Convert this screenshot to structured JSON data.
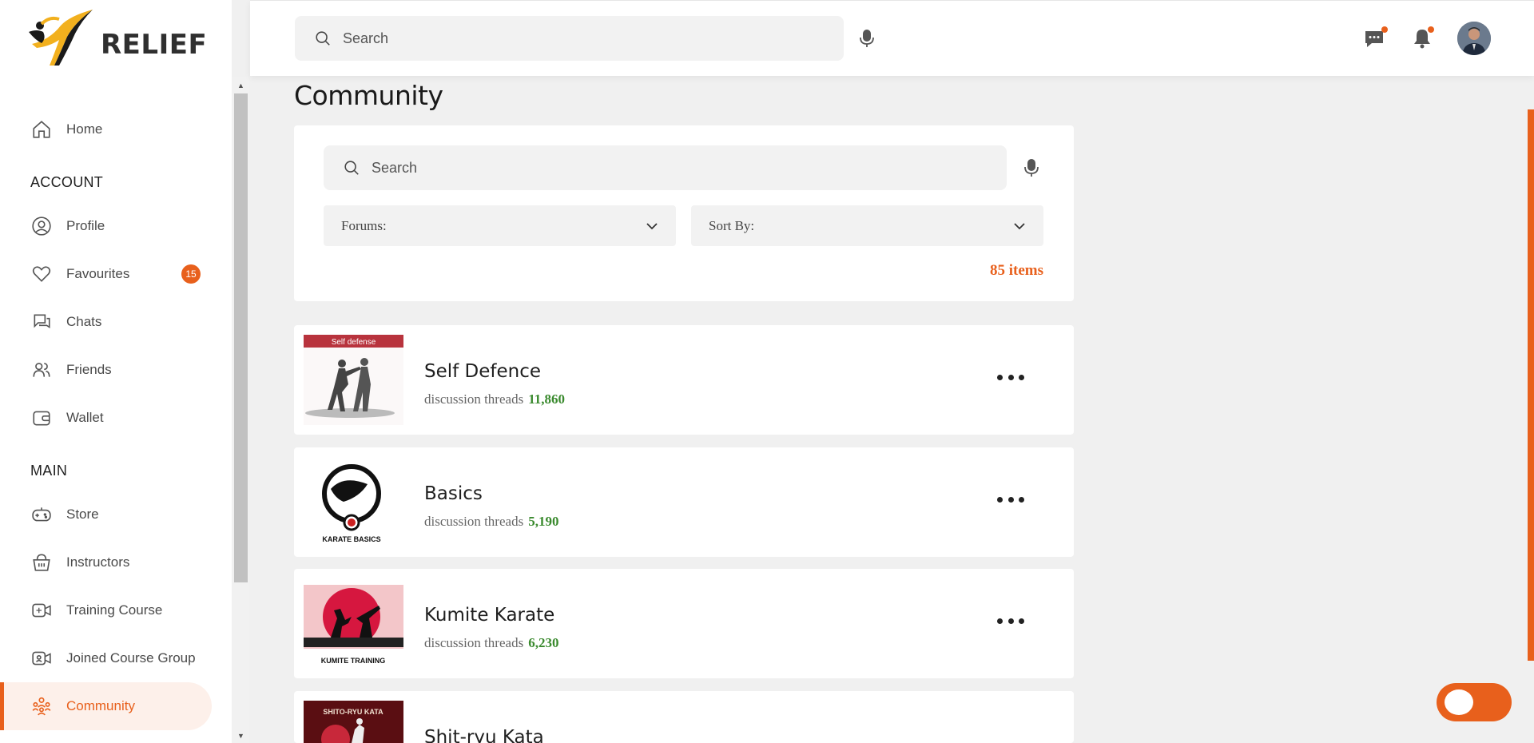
{
  "app": {
    "logo_text": "RELIEF"
  },
  "header": {
    "search_placeholder": "Search",
    "icons": [
      "chat-icon",
      "bell-icon",
      "avatar"
    ]
  },
  "sidebar": {
    "home": "Home",
    "section_account": "ACCOUNT",
    "profile": "Profile",
    "favourites": "Favourites",
    "favourites_badge": "15",
    "chats": "Chats",
    "friends": "Friends",
    "wallet": "Wallet",
    "section_main": "MAIN",
    "store": "Store",
    "instructors": "Instructors",
    "training_course": "Training Course",
    "joined_course_group": "Joined Course Group",
    "community": "Community"
  },
  "main": {
    "title": "Community",
    "search_placeholder": "Search",
    "forums_label": "Forums:",
    "sort_label": "Sort By:",
    "items_count": "85 items",
    "forums": [
      {
        "title": "Self Defence",
        "meta_label": "discussion threads",
        "count": "11,860",
        "thumb_caption": "Self defense"
      },
      {
        "title": "Basics",
        "meta_label": "discussion threads",
        "count": "5,190",
        "thumb_caption": "KARATE BASICS"
      },
      {
        "title": "Kumite Karate",
        "meta_label": "discussion threads",
        "count": "6,230",
        "thumb_caption": "KUMITE TRAINING"
      },
      {
        "title": "Shit-ryu Kata",
        "meta_label": "discussion threads",
        "count": "",
        "thumb_caption": "SHITO-RYU KATA"
      }
    ]
  },
  "colors": {
    "accent": "#e8601c",
    "count_green": "#3a8a2e"
  }
}
